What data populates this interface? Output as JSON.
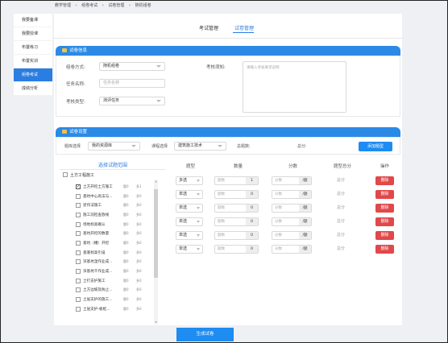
{
  "breadcrumb": [
    "教学管理",
    "组卷考试",
    "试卷管理",
    "随机组卷"
  ],
  "sidebar": {
    "items": [
      {
        "label": "我要备课",
        "active": false
      },
      {
        "label": "我要授课",
        "active": false
      },
      {
        "label": "布置练习",
        "active": false
      },
      {
        "label": "布置实训",
        "active": false
      },
      {
        "label": "组卷考试",
        "active": true
      },
      {
        "label": "成绩分析",
        "active": false
      }
    ]
  },
  "tabs": [
    {
      "label": "考试管理",
      "active": false
    },
    {
      "label": "试卷管理",
      "active": true
    }
  ],
  "paper_info": {
    "title": "试卷信息",
    "mode_label": "组卷方式:",
    "mode_value": "随机组卷",
    "task_label": "任务名称:",
    "task_placeholder": "任务名称",
    "type_label": "考核类型:",
    "type_value": "测评任务",
    "notice_label": "考核须知:",
    "notice_placeholder": "请输入考核要求说明"
  },
  "paper_settings": {
    "title": "试卷设置",
    "bank_label": "题库选择",
    "bank_value": "我的资源库",
    "course_label": "课程选择",
    "course_value": "建筑施工技术",
    "total_q_label": "总题数:",
    "total_score_label": "总分:",
    "add_type_label": "添加题型"
  },
  "scope": {
    "title": "选择试题范围",
    "root": "土方工程施工",
    "items": [
      {
        "name": "土方开挖土方施工",
        "c1": "题0",
        "c2": "多1",
        "checked": true
      },
      {
        "name": "基坑中心高法与...",
        "c1": "题0",
        "c2": "多0",
        "checked": false
      },
      {
        "name": "逆作法施工",
        "c1": "题0",
        "c2": "多0",
        "checked": false
      },
      {
        "name": "施工前检查放线",
        "c1": "题0",
        "c2": "多0",
        "checked": false
      },
      {
        "name": "场地标高确认",
        "c1": "题0",
        "c2": "多0",
        "checked": false
      },
      {
        "name": "基坑开挖的数量",
        "c1": "题0",
        "c2": "多0",
        "checked": false
      },
      {
        "name": "基坑（槽）开挖",
        "c1": "题0",
        "c2": "多0",
        "checked": false
      },
      {
        "name": "基底标高引设",
        "c1": "题0",
        "c2": "多0",
        "checked": false
      },
      {
        "name": "深基坑湿作业成...",
        "c1": "题0",
        "c2": "多0",
        "checked": false
      },
      {
        "name": "深基坑干作业成...",
        "c1": "题0",
        "c2": "多0",
        "checked": false
      },
      {
        "name": "土钉支护施工",
        "c1": "题0",
        "c2": "多0",
        "checked": false
      },
      {
        "name": "土方边坡及防止...",
        "c1": "题0",
        "c2": "多0",
        "checked": false
      },
      {
        "name": "土层支护的施工...",
        "c1": "题0",
        "c2": "多0",
        "checked": false
      },
      {
        "name": "土层支护-板桩...",
        "c1": "题0",
        "c2": "多0",
        "checked": false
      }
    ]
  },
  "question_table": {
    "headers": [
      "题型",
      "数量",
      "分数",
      "题型总分",
      "操作"
    ],
    "rows": [
      {
        "type": "多选",
        "count_placeholder": "题数",
        "count_value": "1",
        "score_placeholder": "分数",
        "score_unit": "/题",
        "total": "总分",
        "delete": "删除"
      },
      {
        "type": "单选",
        "count_placeholder": "题数",
        "count_value": "0",
        "score_placeholder": "分数",
        "score_unit": "/题",
        "total": "总分",
        "delete": "删除"
      },
      {
        "type": "单选",
        "count_placeholder": "题数",
        "count_value": "0",
        "score_placeholder": "分数",
        "score_unit": "/题",
        "total": "总分",
        "delete": "删除"
      },
      {
        "type": "单选",
        "count_placeholder": "题数",
        "count_value": "0",
        "score_placeholder": "分数",
        "score_unit": "/题",
        "total": "总分",
        "delete": "删除"
      },
      {
        "type": "单选",
        "count_placeholder": "题数",
        "count_value": "0",
        "score_placeholder": "分数",
        "score_unit": "/题",
        "total": "总分",
        "delete": "删除"
      },
      {
        "type": "单选",
        "count_placeholder": "题数",
        "count_value": "0",
        "score_placeholder": "分数",
        "score_unit": "/题",
        "total": "总分",
        "delete": "删除"
      }
    ]
  },
  "generate_label": "生成试卷"
}
